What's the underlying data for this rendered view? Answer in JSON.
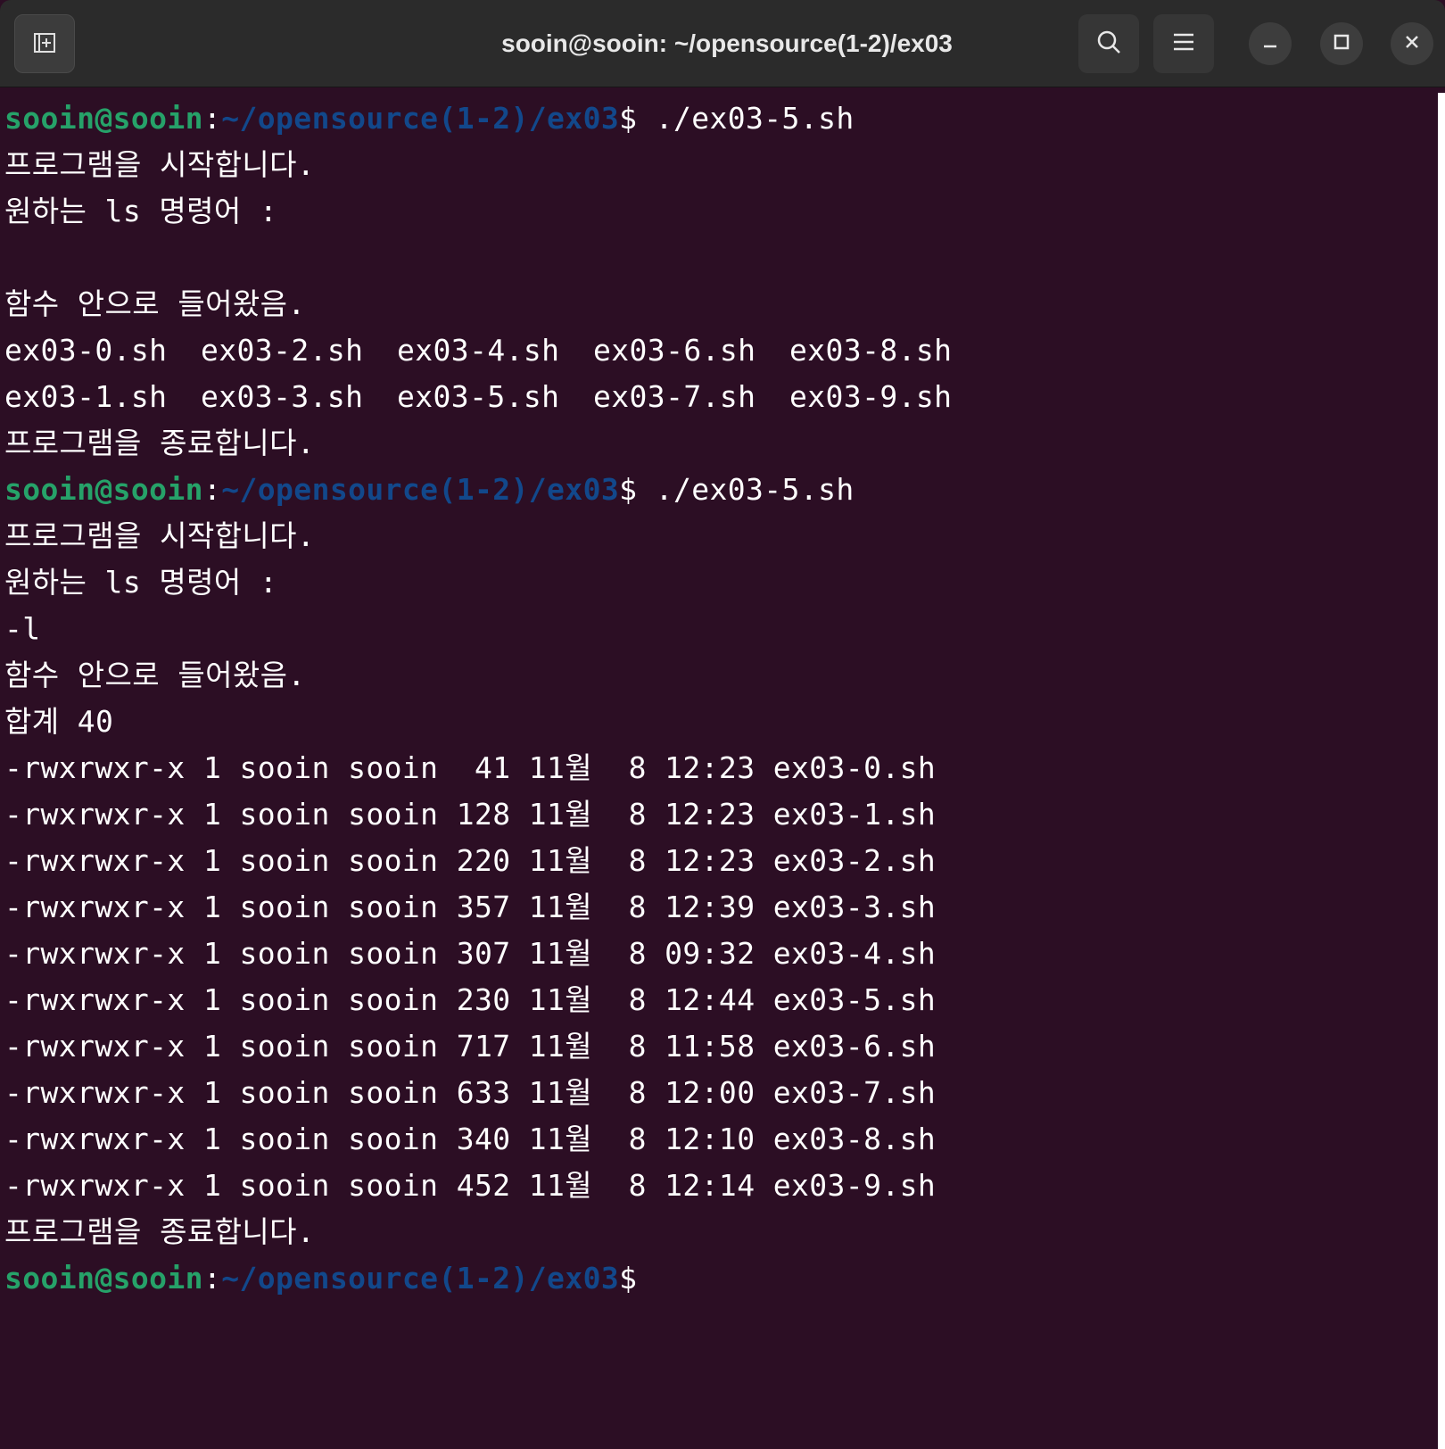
{
  "window": {
    "title": "sooin@sooin: ~/opensource(1-2)/ex03",
    "icons": {
      "new_tab": "new-tab-icon",
      "search": "search-icon",
      "menu": "hamburger-menu-icon",
      "minimize": "minimize-icon",
      "maximize": "maximize-icon",
      "close": "close-icon"
    }
  },
  "colors": {
    "terminal_bg": "#2c0e24",
    "prompt_user": "#26a269",
    "prompt_path": "#12488b",
    "text": "#ffffff"
  },
  "prompt": {
    "user": "sooin@sooin",
    "sep": ":",
    "path": "~/opensource(1-2)/ex03",
    "symbol": "$"
  },
  "session": {
    "cmd1": " ./ex03-5.sh",
    "start1": "프로그램을 시작합니다.",
    "ask1": "원하는 ls 명령어 :",
    "input1": "",
    "infunc1": "함수 안으로 들어왔음.",
    "ls_row1": [
      "ex03-0.sh",
      "ex03-2.sh",
      "ex03-4.sh",
      "ex03-6.sh",
      "ex03-8.sh"
    ],
    "ls_row2": [
      "ex03-1.sh",
      "ex03-3.sh",
      "ex03-5.sh",
      "ex03-7.sh",
      "ex03-9.sh"
    ],
    "end1": "프로그램을 종료합니다.",
    "cmd2": " ./ex03-5.sh",
    "start2": "프로그램을 시작합니다.",
    "ask2": "원하는 ls 명령어 :",
    "input2": "-l",
    "infunc2": "함수 안으로 들어왔음.",
    "total": "합계 40",
    "long_listing": [
      "-rwxrwxr-x 1 sooin sooin  41 11월  8 12:23 ex03-0.sh",
      "-rwxrwxr-x 1 sooin sooin 128 11월  8 12:23 ex03-1.sh",
      "-rwxrwxr-x 1 sooin sooin 220 11월  8 12:23 ex03-2.sh",
      "-rwxrwxr-x 1 sooin sooin 357 11월  8 12:39 ex03-3.sh",
      "-rwxrwxr-x 1 sooin sooin 307 11월  8 09:32 ex03-4.sh",
      "-rwxrwxr-x 1 sooin sooin 230 11월  8 12:44 ex03-5.sh",
      "-rwxrwxr-x 1 sooin sooin 717 11월  8 11:58 ex03-6.sh",
      "-rwxrwxr-x 1 sooin sooin 633 11월  8 12:00 ex03-7.sh",
      "-rwxrwxr-x 1 sooin sooin 340 11월  8 12:10 ex03-8.sh",
      "-rwxrwxr-x 1 sooin sooin 452 11월  8 12:14 ex03-9.sh"
    ],
    "end2": "프로그램을 종료합니다."
  }
}
